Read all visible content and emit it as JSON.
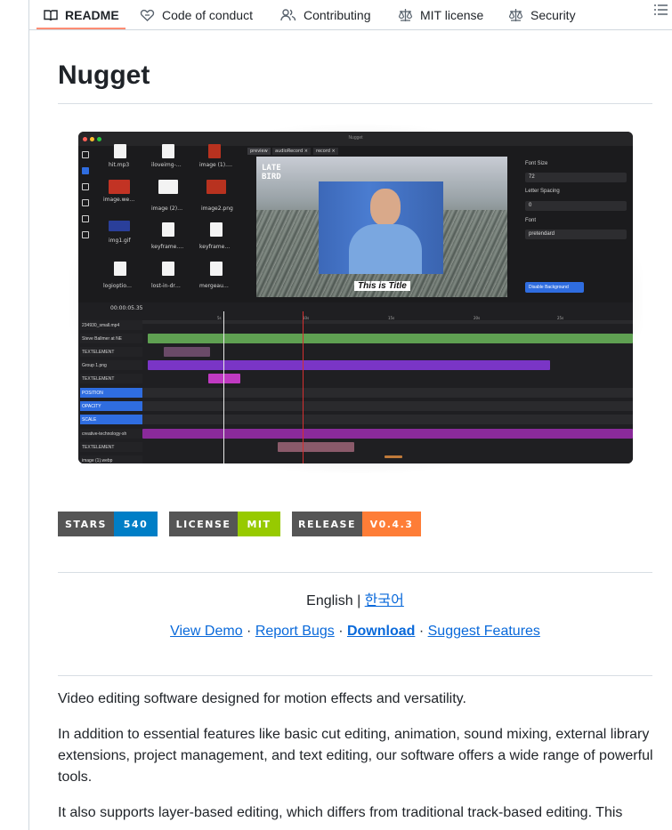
{
  "tabs": {
    "readme": "README",
    "code_of_conduct": "Code of conduct",
    "contributing": "Contributing",
    "license": "MIT license",
    "security": "Security"
  },
  "readme": {
    "title": "Nugget",
    "app_screenshot": {
      "window_title": "Nugget",
      "media_items": [
        "hit.mp3",
        "iloveimg-…",
        "image (1).…",
        "image.we…",
        "image (2)…",
        "image2.png",
        "img1.gif",
        "keyframe.…",
        "keyframe…",
        "logioptio…",
        "lost-in-dr…",
        "mergeau…"
      ],
      "preview_chips": [
        "preview",
        "audioRecord ×",
        "record ×"
      ],
      "overlay_text": "LATE\nBIRD",
      "title_overlay": "This is Title",
      "panel": {
        "font_size_label": "Font Size",
        "font_size_value": "72",
        "letter_spacing_label": "Letter Spacing",
        "letter_spacing_value": "0",
        "font_label": "Font",
        "font_value": "pretendard",
        "disable_background": "Disable Background"
      },
      "timecode": "00:00:05.35",
      "ruler_ticks": [
        "5s",
        "10s",
        "15s",
        "20s",
        "25s"
      ],
      "tracks": [
        "234930_small.mp4",
        "Steve Ballmer at NE",
        "TEXTELEMENT",
        "Group 1.png",
        "TEXTELEMENT",
        "POSITION",
        "OPACITY",
        "SCALE",
        "creative-technology-sh",
        "TEXTELEMENT",
        "image (1).webp"
      ]
    },
    "badges": [
      {
        "label": "STARS",
        "value": "540",
        "color": "#007ec6"
      },
      {
        "label": "LICENSE",
        "value": "MIT",
        "color": "#97ca00"
      },
      {
        "label": "RELEASE",
        "value": "V0.4.3",
        "color": "#fe7d37"
      }
    ],
    "lang_english": "English",
    "lang_sep": " | ",
    "lang_korean": "한국어",
    "links": {
      "view_demo": "View Demo",
      "report_bugs": "Report Bugs",
      "download": "Download",
      "suggest": "Suggest Features",
      "sep": " · "
    },
    "paragraphs": [
      "Video editing software designed for motion effects and versatility.",
      "In addition to essential features like basic cut editing, animation, sound mixing, external library extensions, project management, and text editing, our software offers a wide range of powerful tools.",
      "It also supports layer-based editing, which differs from traditional track-based editing. This"
    ]
  }
}
